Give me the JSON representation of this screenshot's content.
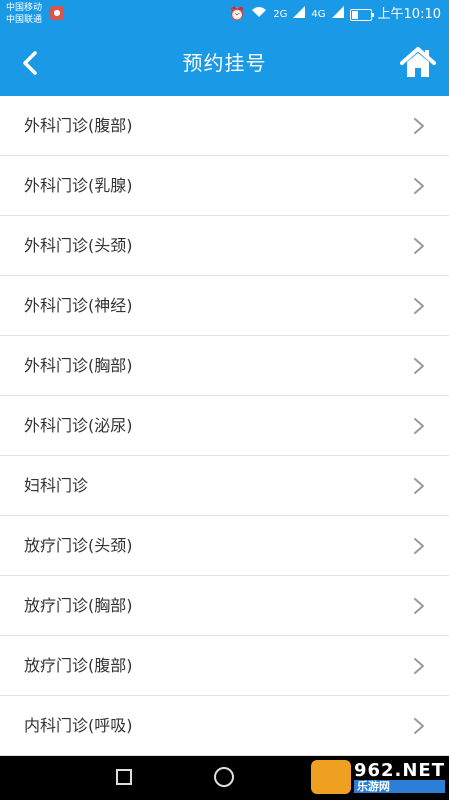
{
  "status": {
    "carrier1": "中国移动",
    "carrier2": "中国联通",
    "net1": "2G",
    "net2": "4G",
    "battery_level": 0.35,
    "time": "上午10:10"
  },
  "header": {
    "title": "预约挂号"
  },
  "list": {
    "items": [
      {
        "label": "外科门诊(腹部)"
      },
      {
        "label": "外科门诊(乳腺)"
      },
      {
        "label": "外科门诊(头颈)"
      },
      {
        "label": "外科门诊(神经)"
      },
      {
        "label": "外科门诊(胸部)"
      },
      {
        "label": "外科门诊(泌尿)"
      },
      {
        "label": "妇科门诊"
      },
      {
        "label": "放疗门诊(头颈)"
      },
      {
        "label": "放疗门诊(胸部)"
      },
      {
        "label": "放疗门诊(腹部)"
      },
      {
        "label": "内科门诊(呼吸)"
      }
    ]
  },
  "watermark": {
    "top": "962.NET",
    "bottom": "乐游网"
  },
  "colors": {
    "primary": "#1a9ae6",
    "divider": "#e2e2e2",
    "chevron": "#999999"
  }
}
